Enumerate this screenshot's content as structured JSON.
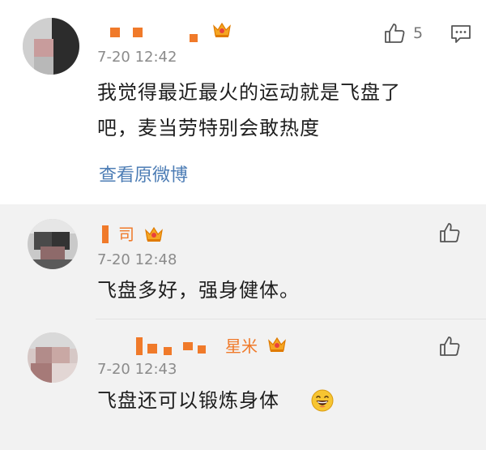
{
  "main_comment": {
    "time": "7-20 12:42",
    "text_line1": "我觉得最近最火的运动就是飞盘了",
    "text_line2": "吧，麦当劳特别会敢热度",
    "like_count": "5",
    "view_original": "查看原微博"
  },
  "replies": [
    {
      "name_fragment": "司",
      "time": "7-20 12:48",
      "text": "飞盘多好，强身健体。"
    },
    {
      "name_fragment": "星米",
      "time": "7-20 12:43",
      "text": "飞盘还可以锻炼身体"
    }
  ],
  "colors": {
    "username": "#f07a2a",
    "link": "#4d7db5",
    "reply_background": "#f2f2f2",
    "time": "#8b8b8b"
  },
  "icons": {
    "like": "thumbs-up-icon",
    "comment": "comment-icon",
    "badge": "crown-icon",
    "emoji": "grinning-face-icon"
  }
}
